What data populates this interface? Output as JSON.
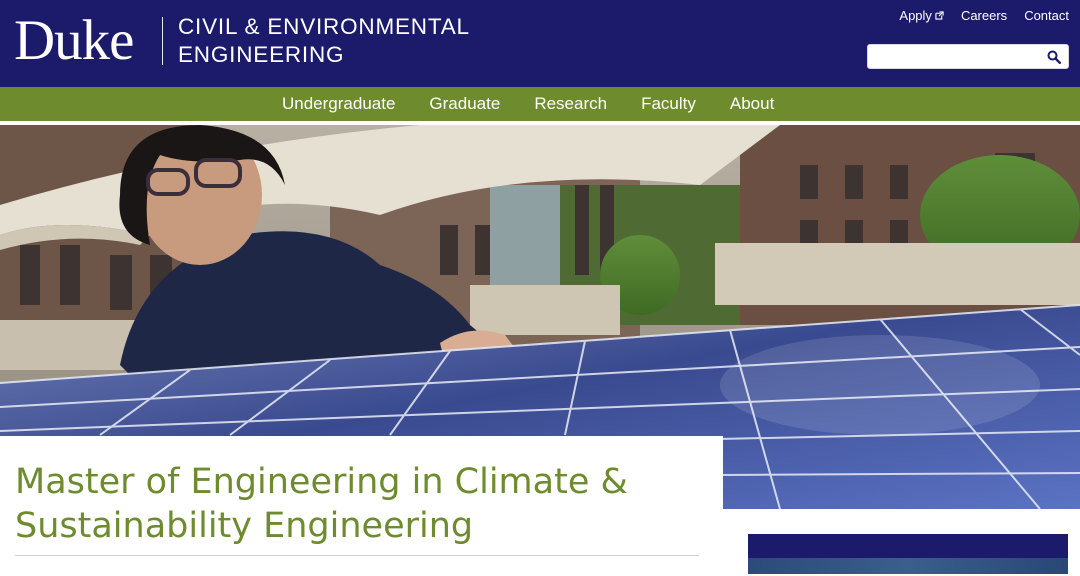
{
  "header": {
    "logo_text": "Duke",
    "department_line1": "CIVIL & ENVIRONMENTAL",
    "department_line2": "ENGINEERING",
    "utility_links": [
      {
        "label": "Apply",
        "external": true
      },
      {
        "label": "Careers"
      },
      {
        "label": "Contact"
      }
    ],
    "search": {
      "value": "",
      "placeholder": ""
    }
  },
  "nav": {
    "items": [
      "Undergraduate",
      "Graduate",
      "Research",
      "Faculty",
      "About"
    ]
  },
  "main": {
    "title": "Master of Engineering in Climate & Sustainability Engineering"
  },
  "colors": {
    "header_bg": "#1c1b6b",
    "nav_bg": "#6e8c2e",
    "title_color": "#6e8c2e"
  },
  "icons": {
    "external_link": "external-link-icon",
    "search": "search-icon"
  }
}
